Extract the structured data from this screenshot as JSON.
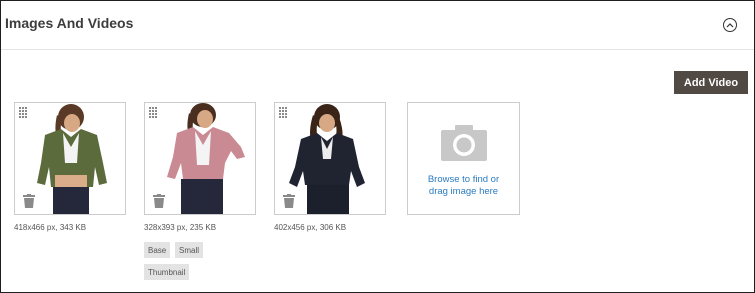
{
  "section": {
    "title": "Images And Videos"
  },
  "toolbar": {
    "add_video_label": "Add Video"
  },
  "images": [
    {
      "caption": "418x466 px, 343 KB",
      "roles": []
    },
    {
      "caption": "328x393 px, 235 KB",
      "roles": [
        "Base",
        "Small",
        "Thumbnail"
      ]
    },
    {
      "caption": "402x456 px, 306 KB",
      "roles": []
    }
  ],
  "upload": {
    "line1": "Browse to find or",
    "line2": "drag image here"
  },
  "colors": {
    "button_bg": "#514943",
    "link": "#2b7bbf",
    "role_bg": "#e3e3e3"
  }
}
